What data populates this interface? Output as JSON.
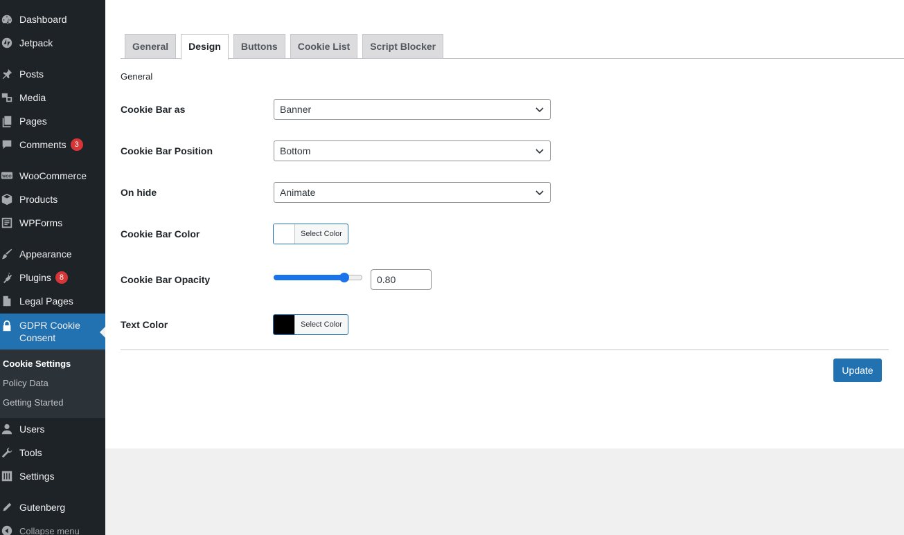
{
  "sidebar": {
    "items": [
      {
        "label": "Dashboard",
        "icon": "dashboard-icon"
      },
      {
        "label": "Jetpack",
        "icon": "jetpack-icon"
      },
      {
        "label": "Posts",
        "icon": "pin-icon"
      },
      {
        "label": "Media",
        "icon": "media-icon"
      },
      {
        "label": "Pages",
        "icon": "pages-icon"
      },
      {
        "label": "Comments",
        "icon": "comment-icon",
        "badge": "3"
      },
      {
        "label": "WooCommerce",
        "icon": "woocommerce-icon"
      },
      {
        "label": "Products",
        "icon": "box-icon"
      },
      {
        "label": "WPForms",
        "icon": "forms-icon"
      },
      {
        "label": "Appearance",
        "icon": "brush-icon"
      },
      {
        "label": "Plugins",
        "icon": "plug-icon",
        "badge": "8"
      },
      {
        "label": "Legal Pages",
        "icon": "document-icon"
      },
      {
        "label": "GDPR Cookie Consent",
        "icon": "lock-icon"
      },
      {
        "label": "Users",
        "icon": "user-icon"
      },
      {
        "label": "Tools",
        "icon": "wrench-icon"
      },
      {
        "label": "Settings",
        "icon": "sliders-icon"
      },
      {
        "label": "Gutenberg",
        "icon": "pencil-icon"
      },
      {
        "label": "Collapse menu",
        "icon": "collapse-icon"
      }
    ],
    "submenu": [
      "Cookie Settings",
      "Policy Data",
      "Getting Started"
    ],
    "accent": "#2271b1",
    "background": "#1d2327"
  },
  "tabs": [
    "General",
    "Design",
    "Buttons",
    "Cookie List",
    "Script Blocker"
  ],
  "active_tab": "Design",
  "section_title": "General",
  "form": {
    "cookie_bar_as": {
      "label": "Cookie Bar as",
      "value": "Banner"
    },
    "cookie_bar_position": {
      "label": "Cookie Bar Position",
      "value": "Bottom"
    },
    "on_hide": {
      "label": "On hide",
      "value": "Animate"
    },
    "cookie_bar_color": {
      "label": "Cookie Bar Color",
      "button": "Select Color",
      "color": "#ffffff"
    },
    "cookie_bar_opacity": {
      "label": "Cookie Bar Opacity",
      "value": "0.80",
      "level": 0.8
    },
    "text_color": {
      "label": "Text Color",
      "button": "Select Color",
      "color": "#000000"
    }
  },
  "update_label": "Update"
}
